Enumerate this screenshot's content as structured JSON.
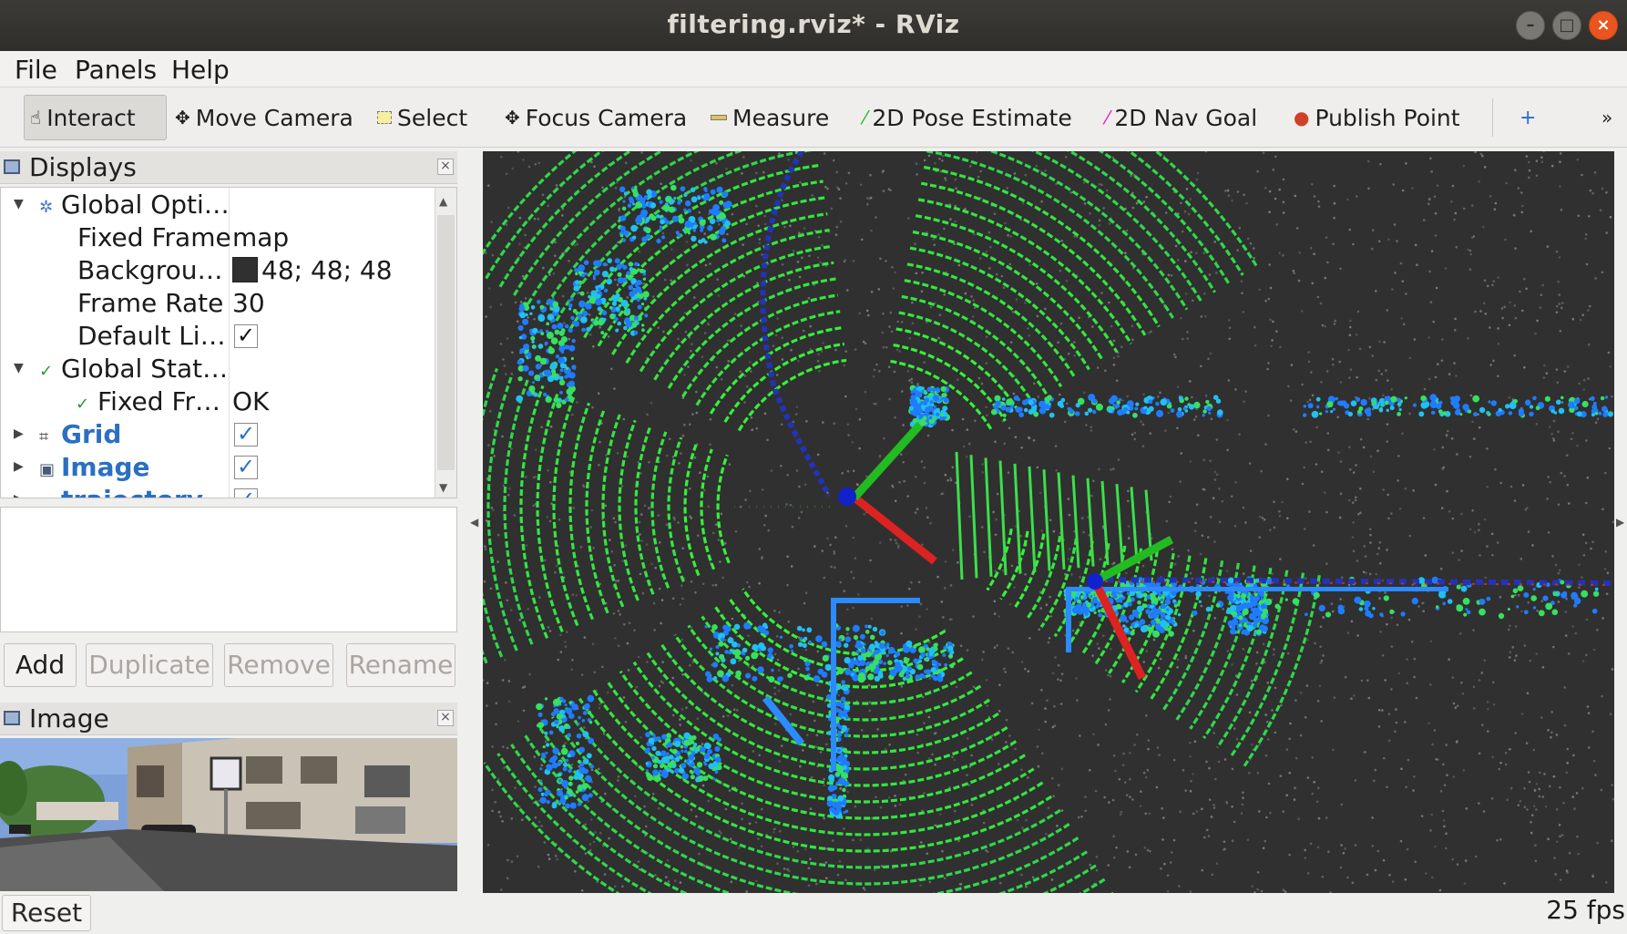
{
  "window": {
    "title": "filtering.rviz* - RViz"
  },
  "menu": {
    "file": "File",
    "panels": "Panels",
    "help": "Help"
  },
  "toolbar": {
    "interact": "Interact",
    "move_camera": "Move Camera",
    "select": "Select",
    "focus_camera": "Focus Camera",
    "measure": "Measure",
    "pose_estimate": "2D Pose Estimate",
    "nav_goal": "2D Nav Goal",
    "publish_point": "Publish Point",
    "overflow": "»"
  },
  "displays": {
    "title": "Displays",
    "rows": [
      {
        "name": "Global Opti…",
        "value": ""
      },
      {
        "name": "Fixed Frame",
        "value": "map"
      },
      {
        "name": "Backgrou…",
        "value": "48; 48; 48"
      },
      {
        "name": "Frame Rate",
        "value": "30"
      },
      {
        "name": "Default Li…",
        "value": ""
      },
      {
        "name": "Global Stat…",
        "value": ""
      },
      {
        "name": "Fixed Fr…",
        "value": "OK"
      },
      {
        "name": "Grid",
        "value": ""
      },
      {
        "name": "Image",
        "value": ""
      },
      {
        "name": "trajectory",
        "value": ""
      }
    ],
    "buttons": {
      "add": "Add",
      "duplicate": "Duplicate",
      "remove": "Remove",
      "rename": "Rename"
    }
  },
  "image_panel": {
    "title": "Image"
  },
  "status": {
    "reset": "Reset",
    "fps": "25 fps"
  },
  "colors": {
    "background": "#303030",
    "points_near": "#33ee33",
    "points_far": "#2277ff",
    "x_axis": "#e02020",
    "y_axis": "#22cc22"
  }
}
